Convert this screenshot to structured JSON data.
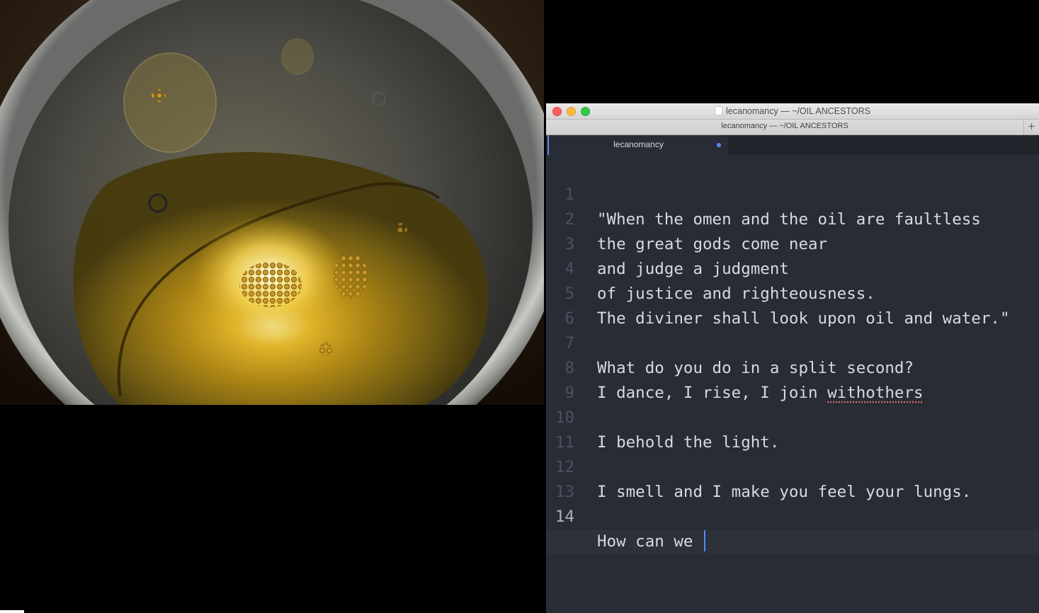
{
  "window": {
    "title": "lecanomancy — ~/OIL ANCESTORS",
    "path_tab": "lecanomancy — ~/OIL ANCESTORS",
    "new_tab_symbol": "+"
  },
  "editor_tab": {
    "title": "lecanomancy",
    "modified": true
  },
  "editor": {
    "active_line": 14,
    "lines": [
      {
        "number": "1",
        "text": "\"When the omen and the oil are faultless"
      },
      {
        "number": "2",
        "text": "the great gods come near"
      },
      {
        "number": "3",
        "text": "and judge a judgment"
      },
      {
        "number": "4",
        "text": "of justice and righteousness."
      },
      {
        "number": "5",
        "text": "The diviner shall look upon oil and water.\""
      },
      {
        "number": "6",
        "text": ""
      },
      {
        "number": "7",
        "text": "What do you do in a split second?"
      },
      {
        "number": "8",
        "text": "I dance, I rise, I join ",
        "misspelled": "withothers"
      },
      {
        "number": "9",
        "text": ""
      },
      {
        "number": "10",
        "text": "I behold the light."
      },
      {
        "number": "11",
        "text": ""
      },
      {
        "number": "12",
        "text": "I smell and I make you feel your lungs."
      },
      {
        "number": "13",
        "text": ""
      },
      {
        "number": "14",
        "text": "How can we "
      }
    ]
  },
  "colors": {
    "editor_bg": "#282c34",
    "text": "#d7dae0",
    "accent": "#568af2"
  }
}
